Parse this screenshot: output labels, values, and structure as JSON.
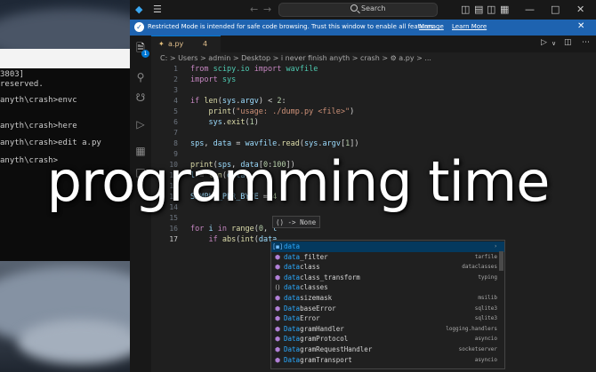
{
  "console": {
    "lines": [
      "3803]",
      "reserved.",
      "anyth\\crash>envc",
      "anyth\\crash>here",
      "anyth\\crash>edit a.py",
      "anyth\\crash>"
    ]
  },
  "vscode": {
    "search_placeholder": "Search",
    "banner": {
      "text": "Restricted Mode is intended for safe code browsing. Trust this window to enable all features.",
      "manage": "Manage",
      "learn_more": "Learn More"
    },
    "activity_badge": "1",
    "tab": {
      "filename": "a.py",
      "problems": "4"
    },
    "breadcrumb": "C: > Users > admin > Desktop > i never finish anyth > crash > ⚙ a.py > ...",
    "line_numbers": [
      "1",
      "2",
      "3",
      "4",
      "5",
      "6",
      "7",
      "8",
      "9",
      "10",
      "11",
      "12",
      "13",
      "14",
      "15",
      "16",
      "17"
    ],
    "signature_hint": "() -> None",
    "suggestions": [
      {
        "icon": "[▪]",
        "match": "data",
        "rest": "",
        "detail": "›"
      },
      {
        "icon": "⬢",
        "match": "data",
        "rest": "_filter",
        "detail": "tarfile"
      },
      {
        "icon": "⬢",
        "match": "data",
        "rest": "class",
        "detail": "dataclasses"
      },
      {
        "icon": "⬢",
        "match": "data",
        "rest": "class_transform",
        "detail": "typing"
      },
      {
        "icon": "()",
        "match": "data",
        "rest": "classes",
        "detail": ""
      },
      {
        "icon": "⬢",
        "match": "data",
        "rest": "sizemask",
        "detail": "msilib"
      },
      {
        "icon": "⬢",
        "match": "Data",
        "rest": "baseError",
        "detail": "sqlite3"
      },
      {
        "icon": "⬢",
        "match": "Data",
        "rest": "Error",
        "detail": "sqlite3"
      },
      {
        "icon": "⬢",
        "match": "Data",
        "rest": "gramHandler",
        "detail": "logging.handlers"
      },
      {
        "icon": "⬢",
        "match": "Data",
        "rest": "gramProtocol",
        "detail": "asyncio"
      },
      {
        "icon": "⬢",
        "match": "Data",
        "rest": "gramRequestHandler",
        "detail": "socketserver"
      },
      {
        "icon": "⬢",
        "match": "Data",
        "rest": "gramTransport",
        "detail": "asyncio"
      }
    ]
  },
  "overlay_caption": "programming time",
  "colors": {
    "banner": "#1e63b0",
    "accent": "#0078d4",
    "editor_bg": "#1f1f1f"
  }
}
